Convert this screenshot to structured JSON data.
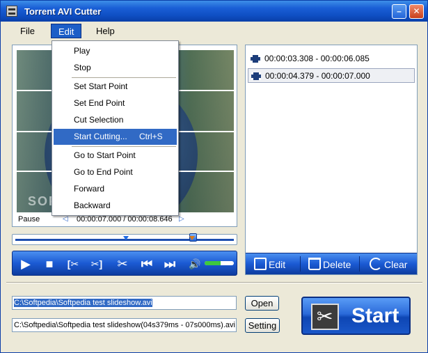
{
  "window": {
    "title": "Torrent AVI Cutter",
    "minimize_glyph": "–",
    "close_glyph": "✕"
  },
  "menubar": {
    "file": "File",
    "edit": "Edit",
    "help": "Help"
  },
  "edit_menu": {
    "items": [
      {
        "label": "Play"
      },
      {
        "label": "Stop"
      },
      {
        "label": "Set Start Point"
      },
      {
        "label": "Set End Point"
      },
      {
        "label": "Cut Selection"
      },
      {
        "label": "Start Cutting...",
        "shortcut": "Ctrl+S",
        "highlighted": true
      },
      {
        "label": "Go to Start Point"
      },
      {
        "label": "Go to End Point"
      },
      {
        "label": "Forward"
      },
      {
        "label": "Backward"
      }
    ]
  },
  "player": {
    "state": "Pause",
    "time": "00:00:07.000 / 00:00:08.646",
    "watermark": "SOFTPEDIA",
    "volume_fraction": 0.55,
    "position_fraction": 0.81
  },
  "segments": {
    "items": [
      {
        "label": "00:00:03.308 - 00:00:06.085",
        "selected": false
      },
      {
        "label": "00:00:04.379 - 00:00:07.000",
        "selected": true
      }
    ],
    "toolbar": {
      "edit": "Edit",
      "delete": "Delete",
      "clear": "Clear"
    }
  },
  "files": {
    "input_path": "C:\\Softpedia\\Softpedia test slideshow.avi",
    "output_path": "C:\\Softpedia\\Softpedia test slideshow(04s379ms - 07s000ms).avi",
    "open_button": "Open",
    "setting_button": "Setting",
    "start_button": "Start"
  },
  "colors": {
    "accent": "#316ac5",
    "title_bar": "#1a5fd6",
    "start_marker": "#1f6be3",
    "end_marker": "#d97a1a"
  }
}
